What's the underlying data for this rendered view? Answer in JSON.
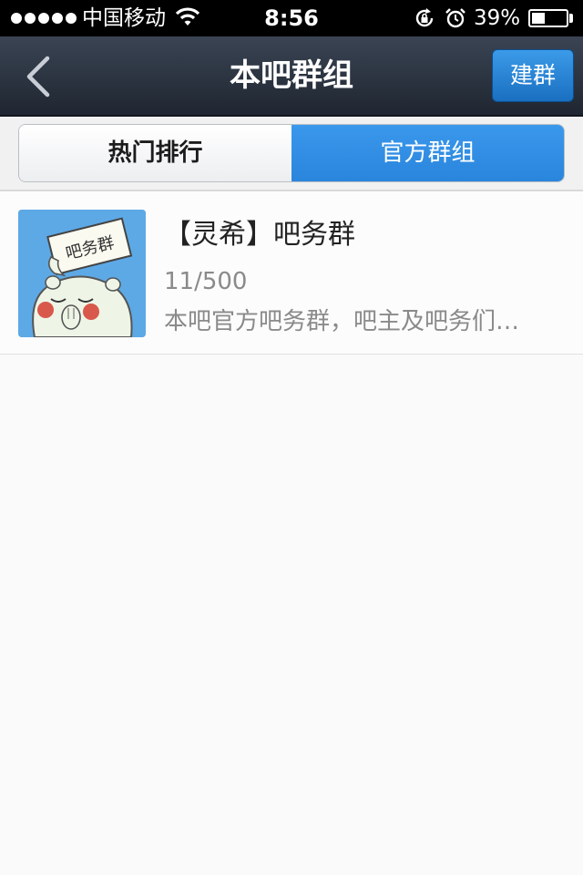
{
  "status_bar": {
    "carrier": "中国移动",
    "time": "8:56",
    "battery_percent": "39%",
    "battery_level": 0.39,
    "icons": [
      "signal-dots-icon",
      "wifi-icon",
      "rotation-lock-icon",
      "alarm-icon",
      "battery-icon"
    ]
  },
  "nav": {
    "title": "本吧群组",
    "create_label": "建群",
    "back_icon": "chevron-left-icon"
  },
  "tabs": [
    {
      "label": "热门排行",
      "selected": false
    },
    {
      "label": "官方群组",
      "selected": true
    }
  ],
  "groups": [
    {
      "name": "【灵希】吧务群",
      "count": "11/500",
      "description": "本吧官方吧务群，吧主及吧务们…",
      "avatar_sign_text": "吧务群"
    }
  ],
  "colors": {
    "nav_bg": "#2b3340",
    "accent_blue": "#2a85dc",
    "avatar_bg": "#5da9e6"
  }
}
